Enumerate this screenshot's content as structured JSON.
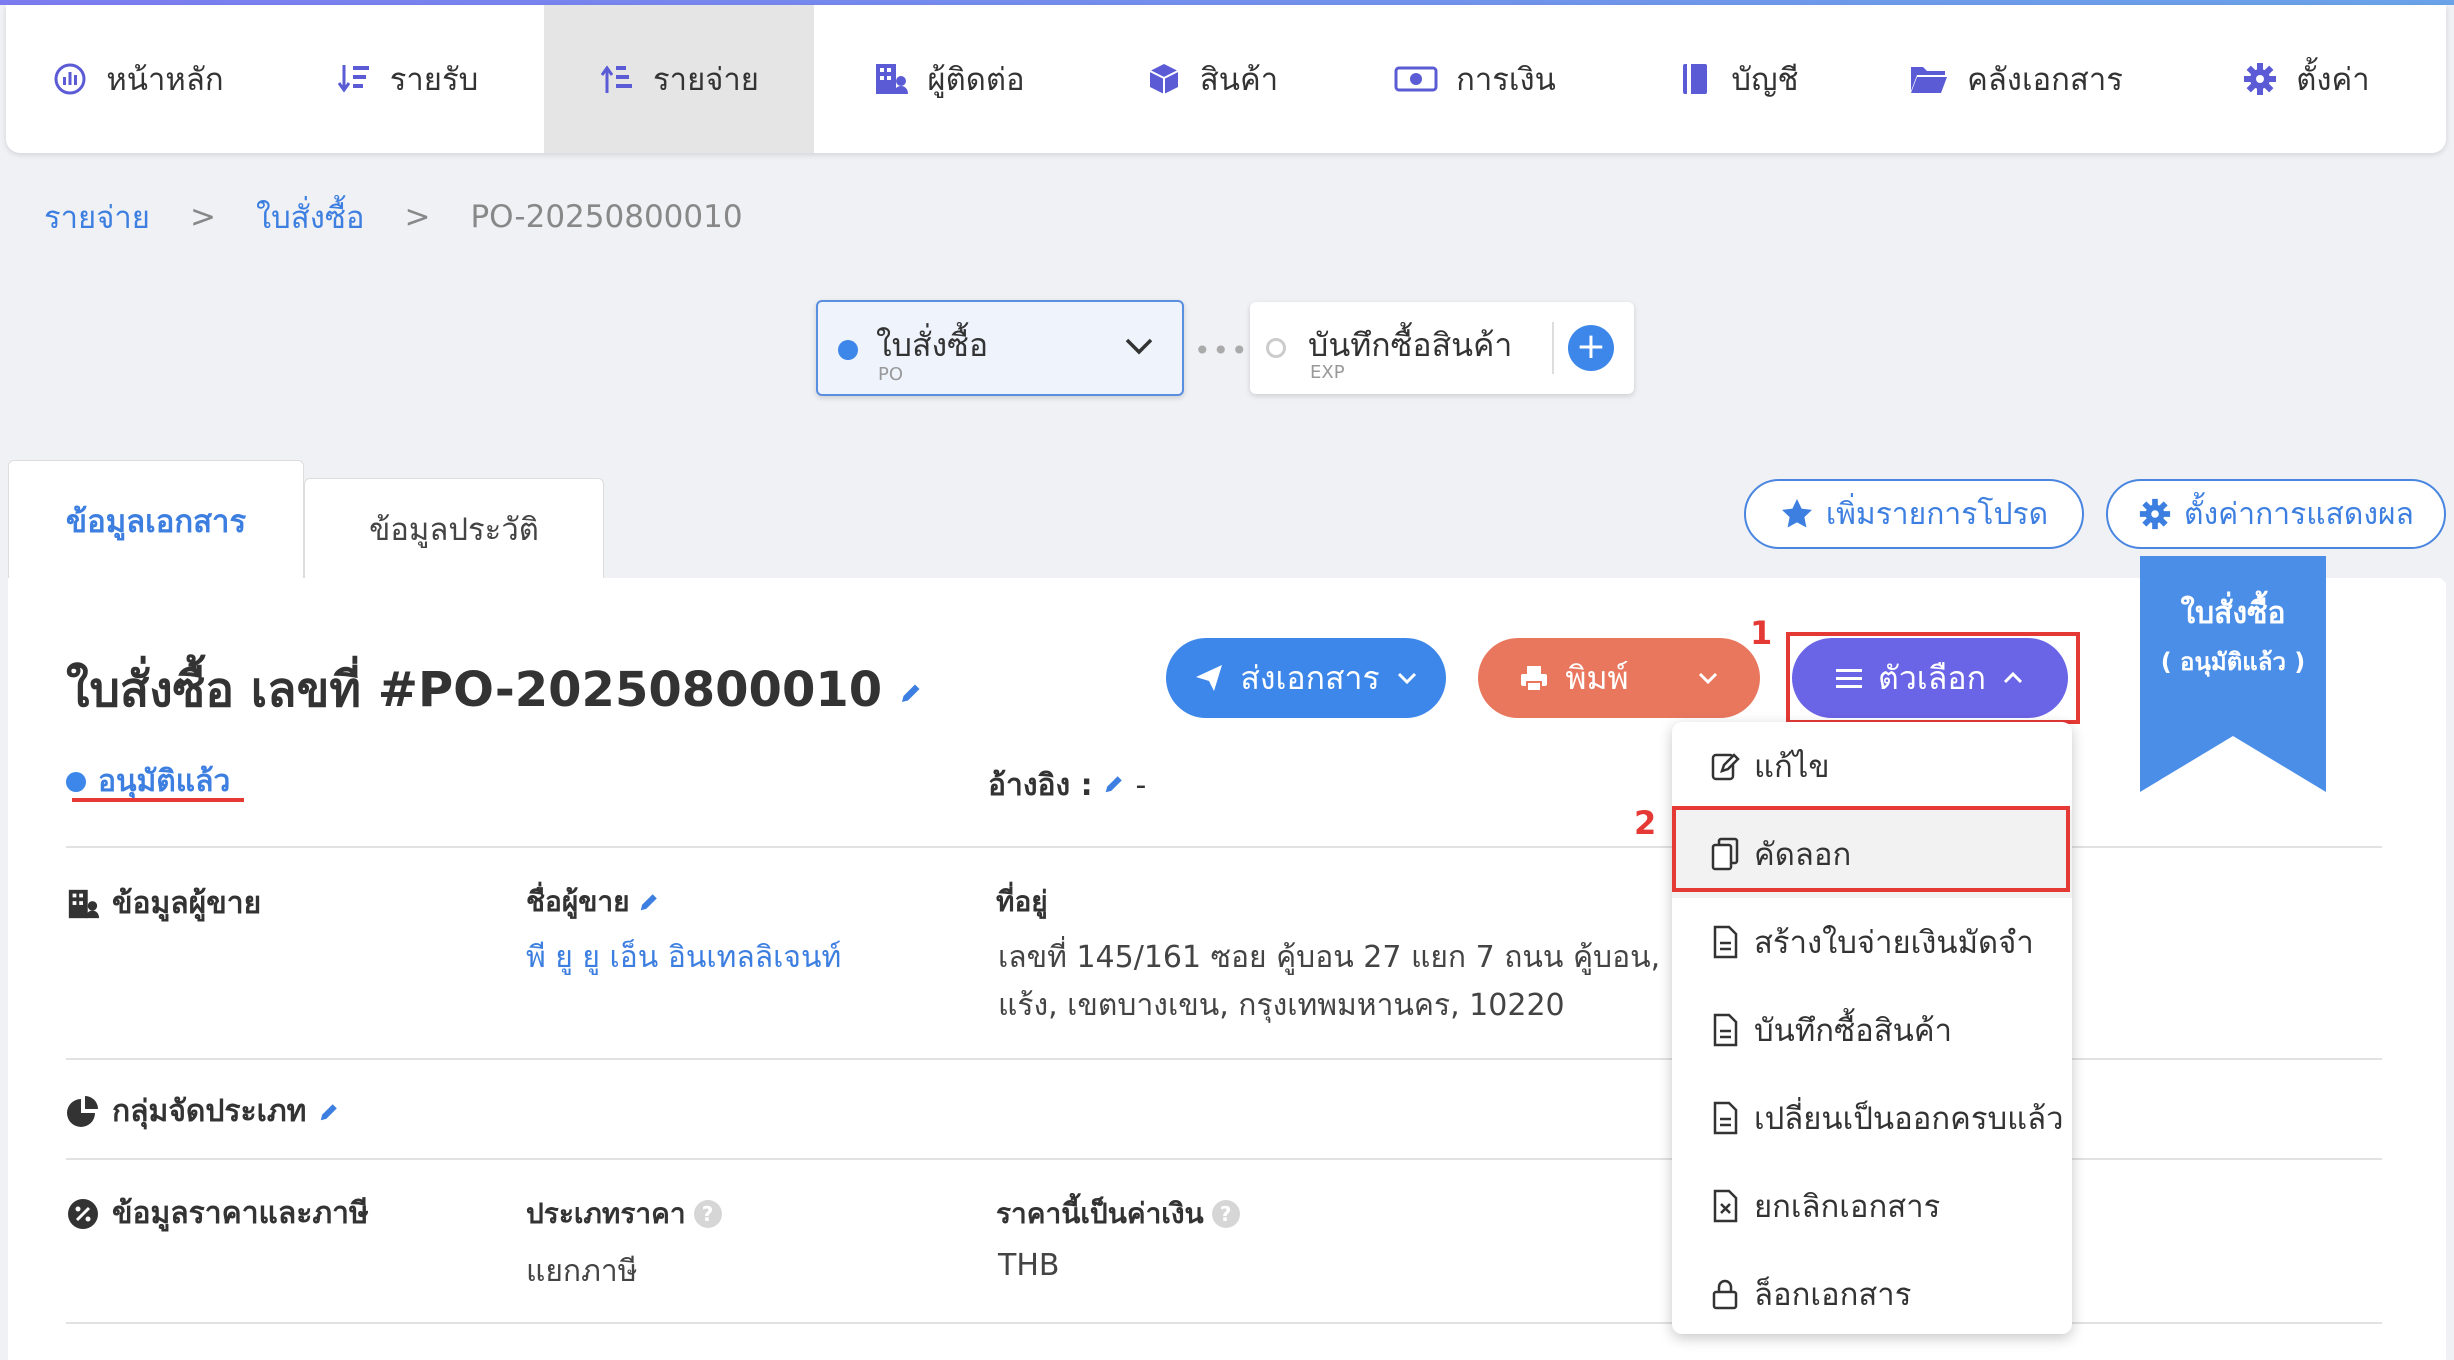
{
  "nav": {
    "items": [
      {
        "label": "หน้าหลัก",
        "icon": "dashboard-icon"
      },
      {
        "label": "รายรับ",
        "icon": "sort-down-icon"
      },
      {
        "label": "รายจ่าย",
        "icon": "sort-up-icon",
        "active": true
      },
      {
        "label": "ผู้ติดต่อ",
        "icon": "building-icon"
      },
      {
        "label": "สินค้า",
        "icon": "box-icon"
      },
      {
        "label": "การเงิน",
        "icon": "money-icon"
      },
      {
        "label": "บัญชี",
        "icon": "book-icon"
      },
      {
        "label": "คลังเอกสาร",
        "icon": "folder-icon"
      },
      {
        "label": "ตั้งค่า",
        "icon": "gear-icon"
      }
    ]
  },
  "breadcrumb": {
    "level1": "รายจ่าย",
    "sep": ">",
    "level2": "ใบสั่งซื้อ",
    "current": "PO-20250800010"
  },
  "flow": {
    "po": {
      "title": "ใบสั่งซื้อ",
      "sub": "PO"
    },
    "dots": "•••",
    "exp": {
      "title": "บันทึกซื้อสินค้า",
      "sub": "EXP"
    },
    "plus": "+"
  },
  "tabs": {
    "doc_info": "ข้อมูลเอกสาร",
    "history": "ข้อมูลประวัติ"
  },
  "top_actions": {
    "favorite": "เพิ่มรายการโปรด",
    "display_settings": "ตั้งค่าการแสดงผล"
  },
  "ribbon": {
    "line1": "ใบสั่งซื้อ",
    "line2": "( อนุมัติแล้ว )"
  },
  "doc": {
    "title": "ใบสั่งซื้อ เลขที่ #PO-20250800010",
    "status": "อนุมัติแล้ว",
    "ref_label": "อ้างอิง :",
    "ref_value": "-"
  },
  "buttons": {
    "send": "ส่งเอกสาร",
    "print": "พิมพ์",
    "options": "ตัวเลือก"
  },
  "annotations": {
    "step1": "1",
    "step2": "2"
  },
  "seller": {
    "section": "ข้อมูลผู้ขาย",
    "name_label": "ชื่อผู้ขาย",
    "name_value": "พี ยู ยู เอ็น อินเทลลิเจนท์",
    "address_label": "ที่อยู่",
    "address_line1": "เลขที่ 145/161 ซอย คู้บอน 27 แยก 7 ถนน คู้บอน, แขว",
    "address_line2": "แร้ง, เขตบางเขน, กรุงเทพมหานคร, 10220"
  },
  "category": {
    "section": "กลุ่มจัดประเภท"
  },
  "pricing": {
    "section": "ข้อมูลราคาและภาษี",
    "price_type_label": "ประเภทราคา",
    "price_type_value": "แยกภาษี",
    "currency_label": "ราคานี้เป็นค่าเงิน",
    "currency_value": "THB"
  },
  "dropdown": {
    "items": [
      {
        "label": "แก้ไข",
        "icon": "edit-icon"
      },
      {
        "label": "คัดลอก",
        "icon": "copy-icon"
      },
      {
        "label": "สร้างใบจ่ายเงินมัดจำ",
        "icon": "document-icon"
      },
      {
        "label": "บันทึกซื้อสินค้า",
        "icon": "document-icon"
      },
      {
        "label": "เปลี่ยนเป็นออกครบแล้ว",
        "icon": "document-icon"
      },
      {
        "label": "ยกเลิกเอกสาร",
        "icon": "cancel-doc-icon"
      },
      {
        "label": "ล็อกเอกสาร",
        "icon": "lock-icon"
      }
    ]
  },
  "colors": {
    "primary": "#3d87ea",
    "print": "#e8775e",
    "options": "#6a64e6",
    "highlight": "#e53935",
    "nav_icon": "#5b5bd6"
  }
}
